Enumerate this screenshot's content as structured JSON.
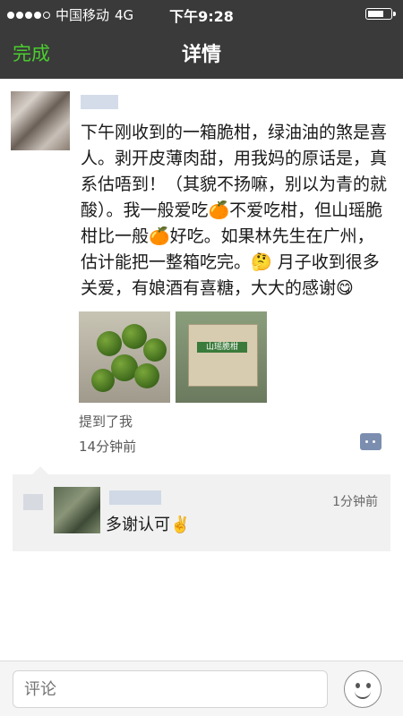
{
  "status_bar": {
    "carrier": "中国移动",
    "network": "4G",
    "time": "下午9:28",
    "signal_bars": 4,
    "battery_level": 0.7
  },
  "nav": {
    "back_label": "完成",
    "title": "详情"
  },
  "post": {
    "text": "下午刚收到的一箱脆柑，绿油油的煞是喜人。剥开皮薄肉甜，用我妈的原话是，真系估唔到！（其貌不扬嘛，别以为青的就酸）。我一般爱吃🍊不爱吃柑，但山瑶脆柑比一般🍊好吃。如果林先生在广州，估计能把一整箱吃完。🤔 月子收到很多关爱，有娘酒有喜糖，大大的感谢😋",
    "photo_1_icon": "green-oranges-photo",
    "photo_2_icon": "orange-box-photo",
    "box_text": "山瑶脆柑",
    "mention": "提到了我",
    "time": "14分钟前"
  },
  "comment": {
    "time": "1分钟前",
    "text": "多谢认可✌️"
  },
  "footer": {
    "input_placeholder": "评论"
  },
  "colors": {
    "nav_bg": "#3a3a3a",
    "back_green": "#4bcc2f",
    "comment_bg": "#f1f1f1"
  }
}
